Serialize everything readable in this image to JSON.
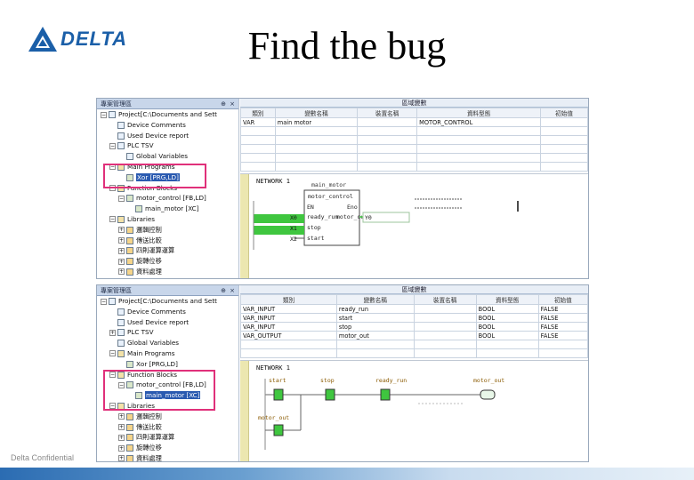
{
  "header": {
    "logo_text": "DELTA",
    "title": "Find the bug"
  },
  "footer": {
    "confidential": "Delta Confidential"
  },
  "colors": {
    "highlight": "#e0307a",
    "brand": "#1b5fa8",
    "contact_green": "#3fc63f"
  },
  "top_panel": {
    "tree_title": "專案管理區",
    "tree_items": [
      {
        "label": "Project[C:\\Documents and Sett",
        "indent": 0,
        "exp": "−",
        "icon": "doc"
      },
      {
        "label": "Device Comments",
        "indent": 1,
        "exp": "",
        "icon": "doc"
      },
      {
        "label": "Used Device report",
        "indent": 1,
        "exp": "",
        "icon": "doc"
      },
      {
        "label": "PLC TSV",
        "indent": 1,
        "exp": "−",
        "icon": "doc"
      },
      {
        "label": "Global Variables",
        "indent": 2,
        "exp": "",
        "icon": "doc"
      },
      {
        "label": "Main Programs",
        "indent": 1,
        "exp": "−",
        "icon": "folder"
      },
      {
        "label": "Xor [PRG,LD]",
        "indent": 2,
        "exp": "",
        "icon": "fb",
        "selected": true
      },
      {
        "label": "Function Blocks",
        "indent": 1,
        "exp": "−",
        "icon": "folder"
      },
      {
        "label": "motor_control [FB,LD]",
        "indent": 2,
        "exp": "−",
        "icon": "fb"
      },
      {
        "label": "main_motor [XC]",
        "indent": 3,
        "exp": "",
        "icon": "fb"
      },
      {
        "label": "Libraries",
        "indent": 1,
        "exp": "−",
        "icon": "folder"
      },
      {
        "label": "邏輯控制",
        "indent": 2,
        "exp": "+",
        "icon": "lib"
      },
      {
        "label": "傳送比較",
        "indent": 2,
        "exp": "+",
        "icon": "lib"
      },
      {
        "label": "四則運算運算",
        "indent": 2,
        "exp": "+",
        "icon": "lib"
      },
      {
        "label": "旋轉位移",
        "indent": 2,
        "exp": "+",
        "icon": "lib"
      },
      {
        "label": "資料處理",
        "indent": 2,
        "exp": "+",
        "icon": "lib"
      }
    ],
    "vars_title": "區域變數",
    "columns": [
      "類別",
      "變數名稱",
      "裝置名稱",
      "資料型態",
      "初始值"
    ],
    "rows": [
      [
        "VAR",
        "main motor",
        "",
        "MOTOR_CONTROL",
        ""
      ]
    ],
    "network": "NETWORK 1",
    "fb_instance": "main_motor",
    "fb_type": "motor_control",
    "fb_inputs": [
      "EN",
      "ready_run",
      "stop",
      "start"
    ],
    "fb_outputs": [
      "Eno",
      "motor_out"
    ],
    "contacts": [
      "X0",
      "X1",
      "X2"
    ],
    "out_coil": "Y0"
  },
  "bottom_panel": {
    "tree_title": "專案管理區",
    "tree_items": [
      {
        "label": "Project[C:\\Documents and Sett",
        "indent": 0,
        "exp": "−",
        "icon": "doc"
      },
      {
        "label": "Device Comments",
        "indent": 1,
        "exp": "",
        "icon": "doc"
      },
      {
        "label": "Used Device report",
        "indent": 1,
        "exp": "",
        "icon": "doc"
      },
      {
        "label": "PLC TSV",
        "indent": 1,
        "exp": "+",
        "icon": "doc"
      },
      {
        "label": "Global Variables",
        "indent": 1,
        "exp": "",
        "icon": "doc"
      },
      {
        "label": "Main Programs",
        "indent": 1,
        "exp": "−",
        "icon": "folder"
      },
      {
        "label": "Xor [PRG,LD]",
        "indent": 2,
        "exp": "",
        "icon": "fb"
      },
      {
        "label": "Function Blocks",
        "indent": 1,
        "exp": "−",
        "icon": "folder"
      },
      {
        "label": "motor_control [FB,LD]",
        "indent": 2,
        "exp": "−",
        "icon": "fb"
      },
      {
        "label": "main_motor [XC]",
        "indent": 3,
        "exp": "",
        "icon": "fb",
        "selected": true
      },
      {
        "label": "Libraries",
        "indent": 1,
        "exp": "−",
        "icon": "folder"
      },
      {
        "label": "邏輯控制",
        "indent": 2,
        "exp": "+",
        "icon": "lib"
      },
      {
        "label": "傳送比較",
        "indent": 2,
        "exp": "+",
        "icon": "lib"
      },
      {
        "label": "四則運算運算",
        "indent": 2,
        "exp": "+",
        "icon": "lib"
      },
      {
        "label": "旋轉位移",
        "indent": 2,
        "exp": "+",
        "icon": "lib"
      },
      {
        "label": "資料處理",
        "indent": 2,
        "exp": "+",
        "icon": "lib"
      }
    ],
    "vars_title": "區域變數",
    "columns": [
      "類別",
      "變數名稱",
      "裝置名稱",
      "資料型態",
      "初始值"
    ],
    "rows": [
      [
        "VAR_INPUT",
        "ready_run",
        "",
        "BOOL",
        "FALSE"
      ],
      [
        "VAR_INPUT",
        "start",
        "",
        "BOOL",
        "FALSE"
      ],
      [
        "VAR_INPUT",
        "stop",
        "",
        "BOOL",
        "FALSE"
      ],
      [
        "VAR_OUTPUT",
        "motor_out",
        "",
        "BOOL",
        "FALSE"
      ]
    ],
    "network": "NETWORK 1",
    "contacts": [
      "start",
      "stop",
      "ready_run",
      "motor_out"
    ],
    "branch_contact": "motor_out"
  }
}
